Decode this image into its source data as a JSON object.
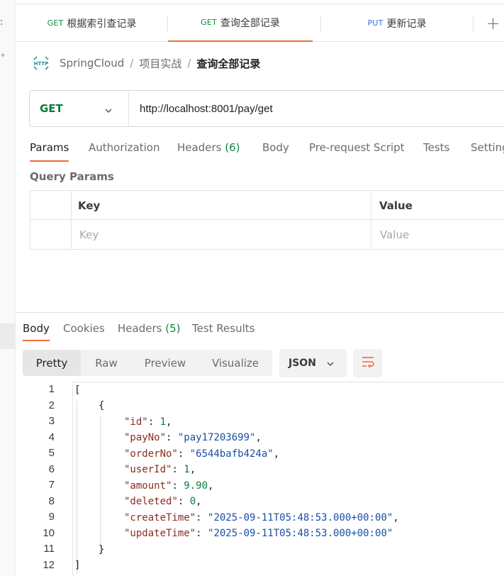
{
  "tabs": [
    {
      "method": "GET",
      "title": "根据索引查记录",
      "active": false
    },
    {
      "method": "GET",
      "title": "查询全部记录",
      "active": true
    },
    {
      "method": "PUT",
      "title": "更新记录",
      "active": false
    }
  ],
  "new_tab_label": "+",
  "breadcrumb": {
    "icon": "http-icon",
    "items": [
      "SpringCloud",
      "项目实战"
    ],
    "current": "查询全部记录",
    "separator": "/"
  },
  "request": {
    "method": "GET",
    "url": "http://localhost:8001/pay/get"
  },
  "request_tabs": {
    "params": "Params",
    "authorization": "Authorization",
    "headers": "Headers",
    "headers_count": "(6)",
    "body": "Body",
    "prerequest": "Pre-request Script",
    "tests": "Tests",
    "settings": "Setting"
  },
  "query_params": {
    "title": "Query Params",
    "header_key": "Key",
    "header_value": "Value",
    "placeholder_key": "Key",
    "placeholder_value": "Value"
  },
  "response_tabs": {
    "body": "Body",
    "cookies": "Cookies",
    "headers": "Headers",
    "headers_count": "(5)",
    "test_results": "Test Results"
  },
  "view_modes": {
    "pretty": "Pretty",
    "raw": "Raw",
    "preview": "Preview",
    "visualize": "Visualize"
  },
  "format": "JSON",
  "code_lines": {
    "n1": "1",
    "n2": "2",
    "n3": "3",
    "n4": "4",
    "n5": "5",
    "n6": "6",
    "n7": "7",
    "n8": "8",
    "n9": "9",
    "n10": "10",
    "n11": "11",
    "n12": "12",
    "open_bracket": "[",
    "open_brace": "{",
    "id_key": "\"id\"",
    "id_val": "1",
    "payNo_key": "\"payNo\"",
    "payNo_val": "\"pay17203699\"",
    "orderNo_key": "\"orderNo\"",
    "orderNo_val": "\"6544bafb424a\"",
    "userId_key": "\"userId\"",
    "userId_val": "1",
    "amount_key": "\"amount\"",
    "amount_val": "9.90",
    "deleted_key": "\"deleted\"",
    "deleted_val": "0",
    "createTime_key": "\"createTime\"",
    "createTime_val": "\"2025-09-11T05:48:53.000+00:00\"",
    "updateTime_key": "\"updateTime\"",
    "updateTime_val": "\"2025-09-11T05:48:53.000+00:00\"",
    "close_brace": "}",
    "close_bracket": "]"
  },
  "colors": {
    "accent": "#f26b3a",
    "get_method": "#0e8a3e",
    "put_method": "#3b6fd6",
    "json_key": "#8a2c1f",
    "json_string": "#1a4fa3",
    "json_number": "#0e7a3a"
  }
}
